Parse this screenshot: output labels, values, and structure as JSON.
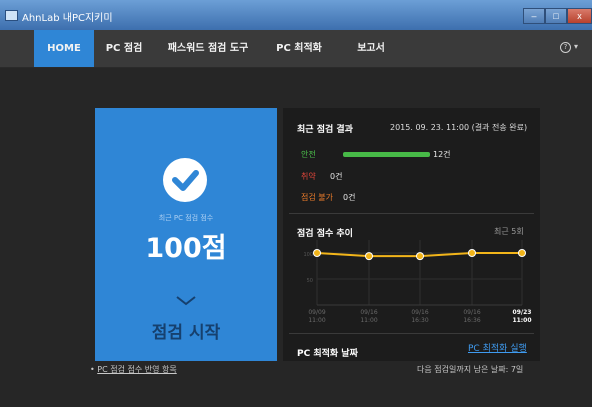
{
  "window": {
    "title": "AhnLab 내PC지키미",
    "min_label": "–",
    "max_label": "□",
    "close_label": "x"
  },
  "nav": {
    "tabs": [
      "HOME",
      "PC 점검",
      "패스워드 점검 도구",
      "PC 최적화",
      "보고서"
    ],
    "active": "HOME",
    "help_label": "?",
    "help_caret": "▾"
  },
  "start_panel": {
    "score_label": "최근 PC 점검 점수",
    "score_value": "100점",
    "start_label": "점검 시작"
  },
  "results": {
    "title": "최근 점검 결과",
    "date": "2015. 09. 23. 11:00 (결과 전송 완료)",
    "items": [
      {
        "label": "안전",
        "count": "12건",
        "color": "#4cc24c",
        "fraction": 1.0
      },
      {
        "label": "취약",
        "count": "0건",
        "color": "#e0463a",
        "fraction": 0.0
      },
      {
        "label": "점검 불가",
        "count": "0건",
        "color": "#e87a2a",
        "fraction": 0.0
      }
    ]
  },
  "trend": {
    "title": "점검 점수 추이",
    "recent_label": "최근 5회",
    "y_ticks": [
      "100",
      "50"
    ],
    "line_color": "#f2b51a"
  },
  "chart_data": {
    "type": "line",
    "title": "점검 점수 추이",
    "x": [
      "09/09 11:00",
      "09/16 11:00",
      "09/16 16:30",
      "09/16 16:36",
      "09/23 11:00"
    ],
    "values": [
      100,
      94,
      94,
      100,
      100
    ],
    "ylim": [
      0,
      100
    ],
    "grid": true
  },
  "optimization": {
    "title": "PC 최적화 날짜",
    "link_label": "PC 최적화 실행",
    "next_label": "다음 점검일까지 남은 날짜: 7일"
  },
  "footer": {
    "bullet": "•",
    "link_label": "PC 점검 점수 반영 항목"
  }
}
